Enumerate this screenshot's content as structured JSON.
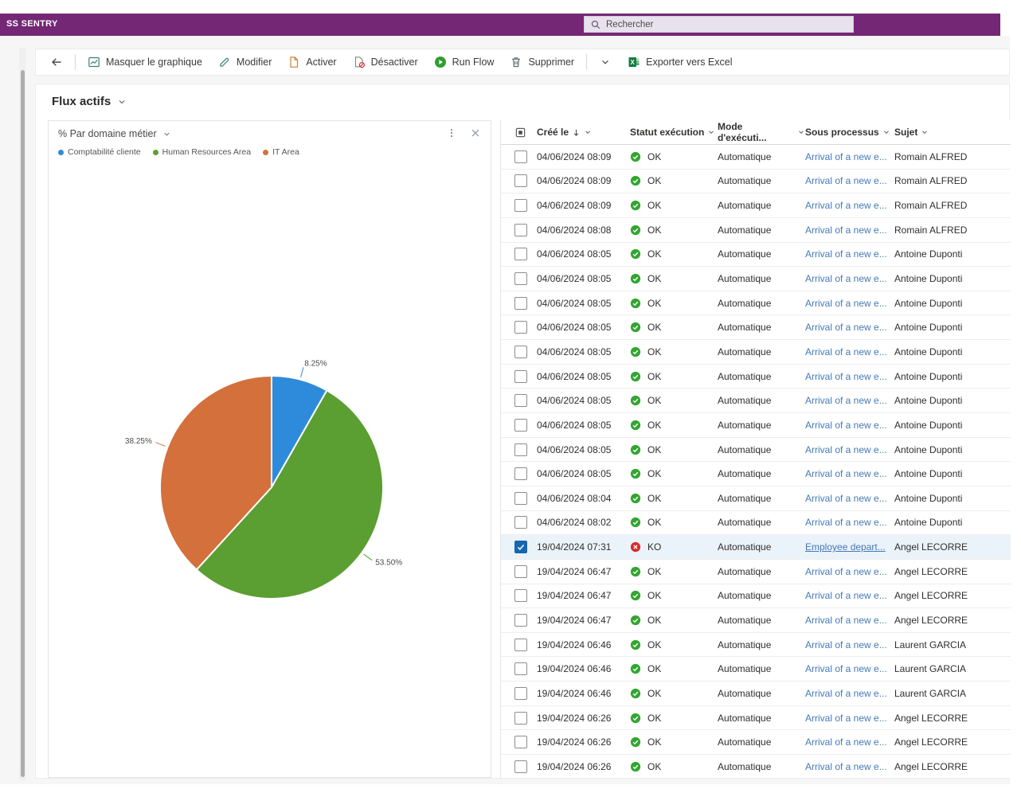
{
  "topbar": {
    "brand": "SS SENTRY",
    "search_placeholder": "Rechercher"
  },
  "toolbar": {
    "items": [
      {
        "type": "button",
        "name": "back",
        "icon": "arrow-left",
        "label": ""
      },
      {
        "type": "divider"
      },
      {
        "type": "button",
        "name": "masquer-le-graphique",
        "icon": "chart",
        "label": "Masquer le graphique"
      },
      {
        "type": "button",
        "name": "modifier",
        "icon": "pencil",
        "label": "Modifier"
      },
      {
        "type": "button",
        "name": "activer",
        "icon": "page-activate",
        "label": "Activer"
      },
      {
        "type": "button",
        "name": "desactiver",
        "icon": "page-deactivate",
        "label": "Désactiver"
      },
      {
        "type": "button",
        "name": "run-flow",
        "icon": "play",
        "label": "Run Flow"
      },
      {
        "type": "button",
        "name": "supprimer",
        "icon": "trash",
        "label": "Supprimer"
      },
      {
        "type": "divider"
      },
      {
        "type": "button",
        "name": "more-commands",
        "icon": "chevron-down",
        "label": ""
      },
      {
        "type": "button",
        "name": "exporter-vers-excel",
        "icon": "excel",
        "label": "Exporter vers Excel"
      }
    ]
  },
  "view": {
    "title": "Flux actifs"
  },
  "chart": {
    "title": "% Par domaine métier",
    "legend": [
      {
        "label": "Comptabilité cliente",
        "color": "#2E8BDB"
      },
      {
        "label": "Human Resources Area",
        "color": "#5B9E31"
      },
      {
        "label": "IT Area",
        "color": "#D3703B"
      }
    ]
  },
  "chart_data": {
    "type": "pie",
    "title": "% Par domaine métier",
    "categories": [
      "Comptabilité cliente",
      "Human Resources Area",
      "IT Area"
    ],
    "values": [
      8.25,
      53.5,
      38.25
    ],
    "labels": [
      "8.25%",
      "53.50%",
      "38.25%"
    ],
    "colors": [
      "#2E8BDB",
      "#5B9E31",
      "#D3703B"
    ],
    "legend_position": "top",
    "start_angle_deg": 0,
    "direction": "clockwise"
  },
  "table": {
    "columns": [
      {
        "key": "created",
        "label": "Créé le",
        "sorted": "desc"
      },
      {
        "key": "status",
        "label": "Statut exécution"
      },
      {
        "key": "mode",
        "label": "Mode d'exécuti..."
      },
      {
        "key": "process",
        "label": "Sous processus"
      },
      {
        "key": "subject",
        "label": "Sujet"
      }
    ],
    "status_labels": {
      "ok": "OK",
      "ko": "KO"
    },
    "rows": [
      {
        "created": "04/06/2024 08:09",
        "status": "OK",
        "mode": "Automatique",
        "process": "Arrival of a new e...",
        "subject": "Romain ALFRED",
        "selected": false,
        "underlined": false
      },
      {
        "created": "04/06/2024 08:09",
        "status": "OK",
        "mode": "Automatique",
        "process": "Arrival of a new e...",
        "subject": "Romain ALFRED",
        "selected": false,
        "underlined": false
      },
      {
        "created": "04/06/2024 08:09",
        "status": "OK",
        "mode": "Automatique",
        "process": "Arrival of a new e...",
        "subject": "Romain ALFRED",
        "selected": false,
        "underlined": false
      },
      {
        "created": "04/06/2024 08:08",
        "status": "OK",
        "mode": "Automatique",
        "process": "Arrival of a new e...",
        "subject": "Romain ALFRED",
        "selected": false,
        "underlined": false
      },
      {
        "created": "04/06/2024 08:05",
        "status": "OK",
        "mode": "Automatique",
        "process": "Arrival of a new e...",
        "subject": "Antoine Duponti",
        "selected": false,
        "underlined": false
      },
      {
        "created": "04/06/2024 08:05",
        "status": "OK",
        "mode": "Automatique",
        "process": "Arrival of a new e...",
        "subject": "Antoine Duponti",
        "selected": false,
        "underlined": false
      },
      {
        "created": "04/06/2024 08:05",
        "status": "OK",
        "mode": "Automatique",
        "process": "Arrival of a new e...",
        "subject": "Antoine Duponti",
        "selected": false,
        "underlined": false
      },
      {
        "created": "04/06/2024 08:05",
        "status": "OK",
        "mode": "Automatique",
        "process": "Arrival of a new e...",
        "subject": "Antoine Duponti",
        "selected": false,
        "underlined": false
      },
      {
        "created": "04/06/2024 08:05",
        "status": "OK",
        "mode": "Automatique",
        "process": "Arrival of a new e...",
        "subject": "Antoine Duponti",
        "selected": false,
        "underlined": false
      },
      {
        "created": "04/06/2024 08:05",
        "status": "OK",
        "mode": "Automatique",
        "process": "Arrival of a new e...",
        "subject": "Antoine Duponti",
        "selected": false,
        "underlined": false
      },
      {
        "created": "04/06/2024 08:05",
        "status": "OK",
        "mode": "Automatique",
        "process": "Arrival of a new e...",
        "subject": "Antoine Duponti",
        "selected": false,
        "underlined": false
      },
      {
        "created": "04/06/2024 08:05",
        "status": "OK",
        "mode": "Automatique",
        "process": "Arrival of a new e...",
        "subject": "Antoine Duponti",
        "selected": false,
        "underlined": false
      },
      {
        "created": "04/06/2024 08:05",
        "status": "OK",
        "mode": "Automatique",
        "process": "Arrival of a new e...",
        "subject": "Antoine Duponti",
        "selected": false,
        "underlined": false
      },
      {
        "created": "04/06/2024 08:05",
        "status": "OK",
        "mode": "Automatique",
        "process": "Arrival of a new e...",
        "subject": "Antoine Duponti",
        "selected": false,
        "underlined": false
      },
      {
        "created": "04/06/2024 08:04",
        "status": "OK",
        "mode": "Automatique",
        "process": "Arrival of a new e...",
        "subject": "Antoine Duponti",
        "selected": false,
        "underlined": false
      },
      {
        "created": "04/06/2024 08:02",
        "status": "OK",
        "mode": "Automatique",
        "process": "Arrival of a new e...",
        "subject": "Antoine Duponti",
        "selected": false,
        "underlined": false
      },
      {
        "created": "19/04/2024 07:31",
        "status": "KO",
        "mode": "Automatique",
        "process": "Employee depart...",
        "subject": "Angel LECORRE",
        "selected": true,
        "underlined": true
      },
      {
        "created": "19/04/2024 06:47",
        "status": "OK",
        "mode": "Automatique",
        "process": "Arrival of a new e...",
        "subject": "Angel LECORRE",
        "selected": false,
        "underlined": false
      },
      {
        "created": "19/04/2024 06:47",
        "status": "OK",
        "mode": "Automatique",
        "process": "Arrival of a new e...",
        "subject": "Angel LECORRE",
        "selected": false,
        "underlined": false
      },
      {
        "created": "19/04/2024 06:47",
        "status": "OK",
        "mode": "Automatique",
        "process": "Arrival of a new e...",
        "subject": "Angel LECORRE",
        "selected": false,
        "underlined": false
      },
      {
        "created": "19/04/2024 06:46",
        "status": "OK",
        "mode": "Automatique",
        "process": "Arrival of a new e...",
        "subject": "Laurent GARCIA",
        "selected": false,
        "underlined": false
      },
      {
        "created": "19/04/2024 06:46",
        "status": "OK",
        "mode": "Automatique",
        "process": "Arrival of a new e...",
        "subject": "Laurent GARCIA",
        "selected": false,
        "underlined": false
      },
      {
        "created": "19/04/2024 06:46",
        "status": "OK",
        "mode": "Automatique",
        "process": "Arrival of a new e...",
        "subject": "Laurent GARCIA",
        "selected": false,
        "underlined": false
      },
      {
        "created": "19/04/2024 06:26",
        "status": "OK",
        "mode": "Automatique",
        "process": "Arrival of a new e...",
        "subject": "Angel LECORRE",
        "selected": false,
        "underlined": false
      },
      {
        "created": "19/04/2024 06:26",
        "status": "OK",
        "mode": "Automatique",
        "process": "Arrival of a new e...",
        "subject": "Angel LECORRE",
        "selected": false,
        "underlined": false
      },
      {
        "created": "19/04/2024 06:26",
        "status": "OK",
        "mode": "Automatique",
        "process": "Arrival of a new e...",
        "subject": "Angel LECORRE",
        "selected": false,
        "underlined": false
      }
    ]
  },
  "status_colors": {
    "ok": "#33A532",
    "ko": "#D92C2C"
  }
}
